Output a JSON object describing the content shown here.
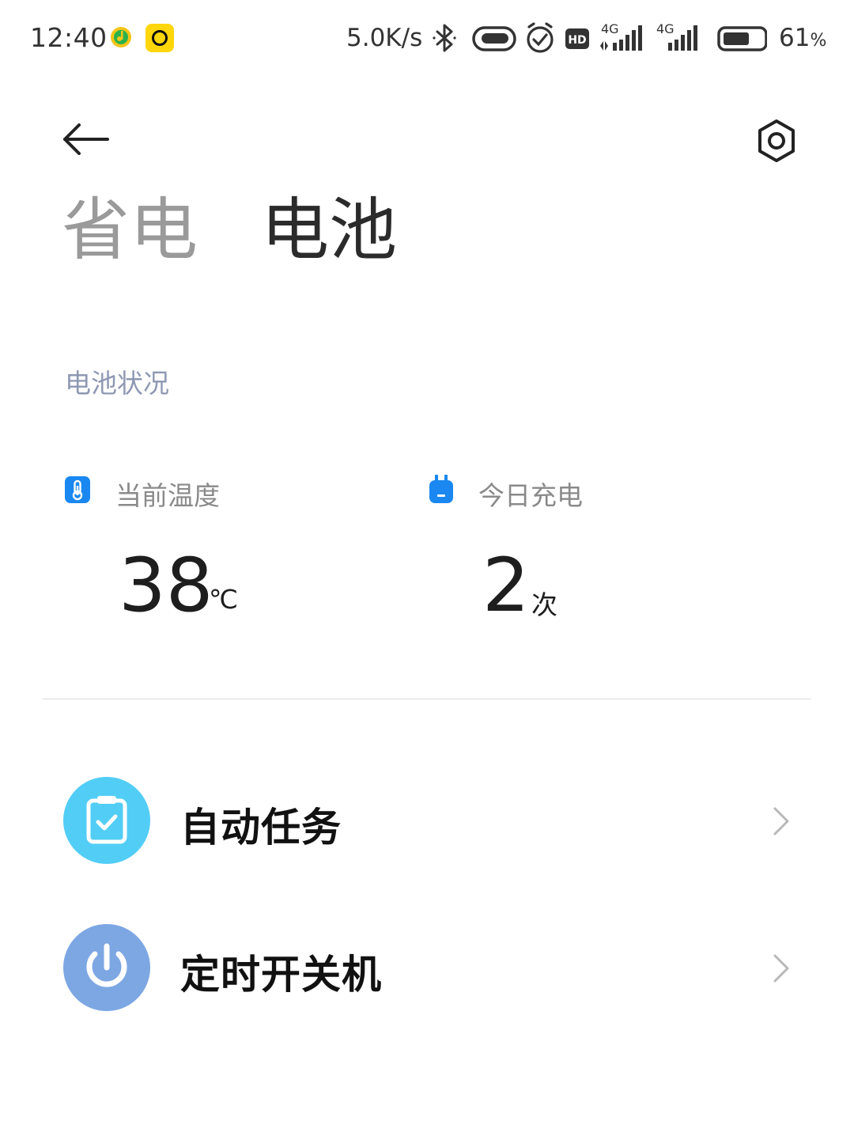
{
  "status_bar": {
    "time": "12:40",
    "net_speed": "5.0K/s",
    "battery_percent": "61",
    "battery_percent_unit": "%",
    "icons": [
      "qq-music-icon",
      "yellow-app-icon",
      "bluetooth-icon",
      "link-icon",
      "alarm-icon",
      "hd-icon",
      "signal-4g-icon",
      "signal-4g-icon",
      "battery-icon"
    ]
  },
  "header": {
    "tabs": [
      {
        "label": "省电",
        "active": false
      },
      {
        "label": "电池",
        "active": true
      }
    ]
  },
  "battery_status": {
    "section_title": "电池状况",
    "temperature": {
      "label": "当前温度",
      "value": "38",
      "unit": "℃"
    },
    "charge_count": {
      "label": "今日充电",
      "value": "2",
      "unit": "次"
    }
  },
  "list": {
    "items": [
      {
        "label": "自动任务",
        "icon": "clipboard-check-icon",
        "color": "#52cdf6"
      },
      {
        "label": "定时开关机",
        "icon": "power-icon",
        "color": "#7da7e3"
      }
    ]
  },
  "colors": {
    "accent_blue": "#1a88f0",
    "section_title": "#8e98b3"
  }
}
